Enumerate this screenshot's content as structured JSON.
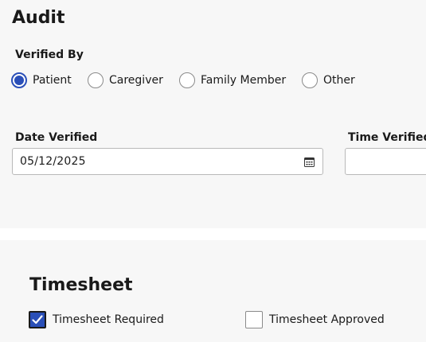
{
  "audit": {
    "title": "Audit",
    "verified_by": {
      "label": "Verified By",
      "options": [
        {
          "label": "Patient",
          "checked": true
        },
        {
          "label": "Caregiver",
          "checked": false
        },
        {
          "label": "Family Member",
          "checked": false
        },
        {
          "label": "Other",
          "checked": false
        }
      ]
    },
    "date_verified": {
      "label": "Date Verified",
      "value": "05/12/2025",
      "icon": "calendar-icon"
    },
    "time_verified": {
      "label": "Time Verified",
      "value": ""
    }
  },
  "timesheet": {
    "title": "Timesheet",
    "required": {
      "label": "Timesheet Required",
      "checked": true
    },
    "approved": {
      "label": "Timesheet Approved",
      "checked": false
    }
  },
  "colors": {
    "accent": "#2a4fb8",
    "panel_bg": "#f7f7f7",
    "separator": "#ffffff"
  }
}
